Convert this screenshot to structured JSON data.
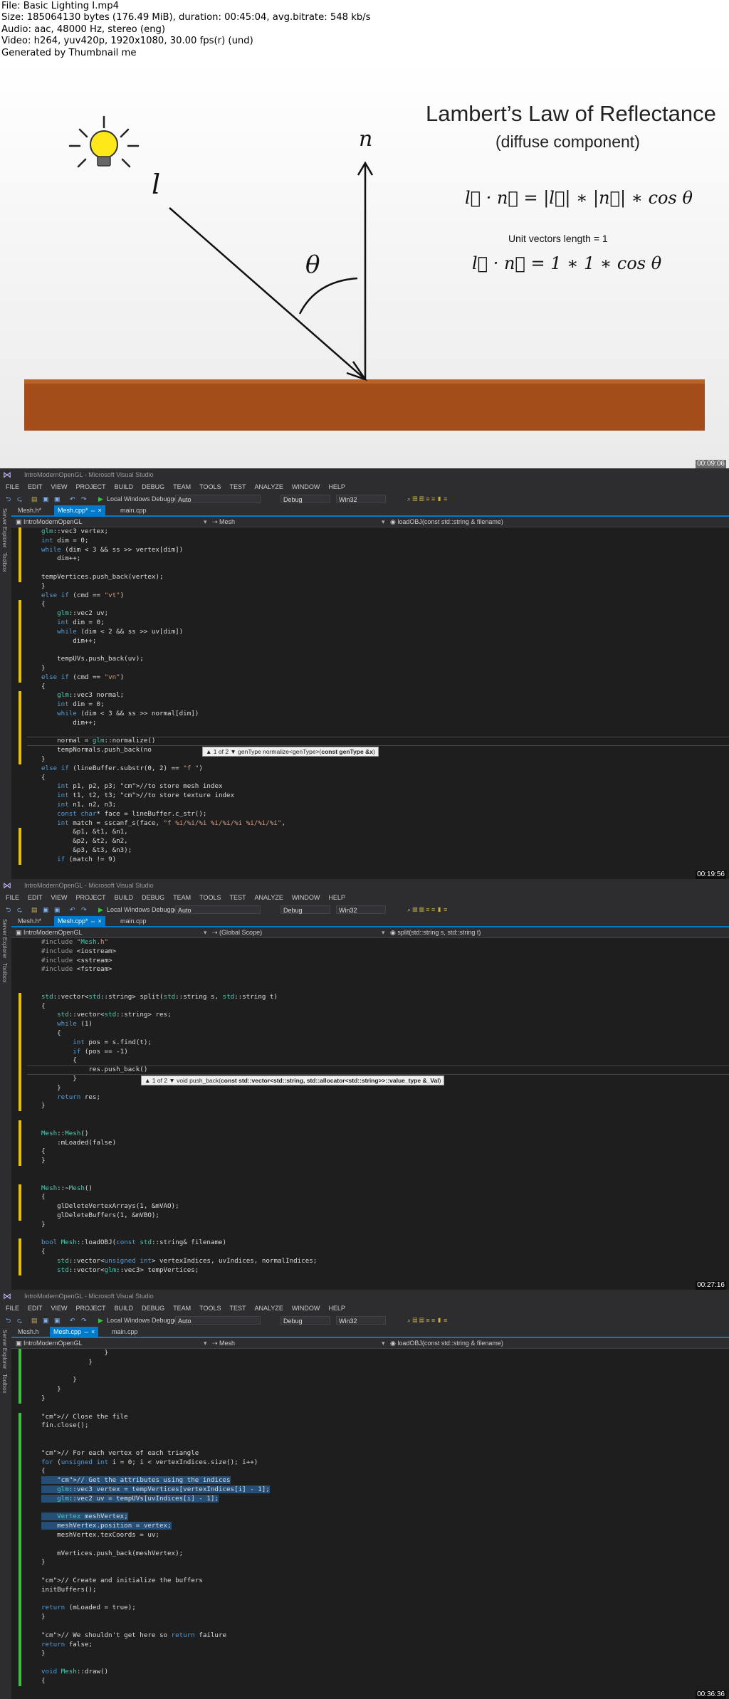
{
  "header": {
    "lines": [
      "File: Basic Lighting I.mp4",
      "Size: 185064130 bytes (176.49 MiB), duration: 00:45:04, avg.bitrate: 548 kb/s",
      "Audio: aac, 48000 Hz, stereo (eng)",
      "Video: h264, yuv420p, 1920x1080, 30.00 fps(r) (und)",
      "Generated by Thumbnail me"
    ]
  },
  "slide": {
    "title": "Lambert’s Law of Reflectance",
    "subtitle": "(diffuse component)",
    "label_l": "l",
    "label_n": "n",
    "label_theta": "θ",
    "formula1": "l⃗ · n⃗ = |l⃗| ∗ |n⃗| ∗ cos θ",
    "unit_note": "Unit vectors length = 1",
    "formula2": "l⃗ · n⃗ = 1 ∗ 1 ∗ cos θ",
    "timestamp": "00:09:06"
  },
  "vs": {
    "window_title": "IntroModernOpenGL - Microsoft Visual Studio",
    "menu": [
      "FILE",
      "EDIT",
      "VIEW",
      "PROJECT",
      "BUILD",
      "DEBUG",
      "TEAM",
      "TOOLS",
      "TEST",
      "ANALYZE",
      "WINDOW",
      "HELP"
    ],
    "debugger_label": "Local Windows Debugger",
    "combo_auto": "Auto",
    "combo_config": "Debug",
    "combo_platform": "Win32",
    "side_server": "Server Explorer",
    "side_toolbox": "Toolbox",
    "project": "IntroModernOpenGL"
  },
  "frames": [
    {
      "tabs": [
        "Mesh.h*",
        "Mesh.cpp*",
        "main.cpp"
      ],
      "active_tab": 1,
      "nav_scope": "Mesh",
      "nav_member": "loadOBJ(const std::string & filename)",
      "timestamp": "00:19:56",
      "tooltip": {
        "prefix": "▲ 1 of 2 ▼  genType normalize<genType>(",
        "bold": "const genType &x",
        "suffix": ")"
      },
      "code": [
        "glm::vec3 vertex;",
        "int dim = 0;",
        "while (dim < 3 && ss >> vertex[dim])",
        "    dim++;",
        "",
        "tempVertices.push_back(vertex);",
        "}",
        "else if (cmd == \"vt\")",
        "{",
        "    glm::vec2 uv;",
        "    int dim = 0;",
        "    while (dim < 2 && ss >> uv[dim])",
        "        dim++;",
        "",
        "    tempUVs.push_back(uv);",
        "}",
        "else if (cmd == \"vn\")",
        "{",
        "    glm::vec3 normal;",
        "    int dim = 0;",
        "    while (dim < 3 && ss >> normal[dim])",
        "        dim++;",
        "",
        "    normal = glm::normalize()",
        "    tempNormals.push_back(no",
        "}",
        "else if (lineBuffer.substr(0, 2) == \"f \")",
        "{",
        "    int p1, p2, p3; //to store mesh index",
        "    int t1, t2, t3; //to store texture index",
        "    int n1, n2, n3;",
        "    const char* face = lineBuffer.c_str();",
        "    int match = sscanf_s(face, \"f %i/%i/%i %i/%i/%i %i/%i/%i\",",
        "        &p1, &t1, &n1,",
        "        &p2, &t2, &n2,",
        "        &p3, &t3, &n3);",
        "    if (match != 9)"
      ]
    },
    {
      "tabs": [
        "Mesh.h*",
        "Mesh.cpp*",
        "main.cpp"
      ],
      "active_tab": 1,
      "nav_scope": "(Global Scope)",
      "nav_member": "split(std::string s, std::string t)",
      "timestamp": "00:27:16",
      "tooltip": {
        "prefix": "▲ 1 of 2 ▼  void push_back(",
        "bold": "const std::vector<std::string, std::allocator<std::string>>::value_type &_Val",
        "suffix": ")"
      },
      "code": [
        "#include \"Mesh.h\"",
        "#include <iostream>",
        "#include <sstream>",
        "#include <fstream>",
        "",
        "",
        "std::vector<std::string> split(std::string s, std::string t)",
        "{",
        "    std::vector<std::string> res;",
        "    while (1)",
        "    {",
        "        int pos = s.find(t);",
        "        if (pos == -1)",
        "        {",
        "            res.push_back()",
        "        }",
        "    }",
        "    return res;",
        "}",
        "",
        "",
        "Mesh::Mesh()",
        "    :mLoaded(false)",
        "{",
        "}",
        "",
        "",
        "Mesh::~Mesh()",
        "{",
        "    glDeleteVertexArrays(1, &mVAO);",
        "    glDeleteBuffers(1, &mVBO);",
        "}",
        "",
        "bool Mesh::loadOBJ(const std::string& filename)",
        "{",
        "    std::vector<unsigned int> vertexIndices, uvIndices, normalIndices;",
        "    std::vector<glm::vec3> tempVertices;"
      ]
    },
    {
      "tabs": [
        "Mesh.h",
        "Mesh.cpp",
        "main.cpp"
      ],
      "active_tab": 1,
      "nav_scope": "Mesh",
      "nav_member": "loadOBJ(const std::string & filename)",
      "timestamp": "00:36:36",
      "code": [
        "                }",
        "            }",
        "",
        "        }",
        "    }",
        "}",
        "",
        "// Close the file",
        "fin.close();",
        "",
        "",
        "// For each vertex of each triangle",
        "for (unsigned int i = 0; i < vertexIndices.size(); i++)",
        "{",
        "    // Get the attributes using the indices",
        "    glm::vec3 vertex = tempVertices[vertexIndices[i] - 1];",
        "    glm::vec2 uv = tempUVs[uvIndices[i] - 1];",
        "",
        "    Vertex meshVertex;",
        "    meshVertex.position = vertex;",
        "    meshVertex.texCoords = uv;",
        "",
        "    mVertices.push_back(meshVertex);",
        "}",
        "",
        "// Create and initialize the buffers",
        "initBuffers();",
        "",
        "return (mLoaded = true);",
        "}",
        "",
        "// We shouldn't get here so return failure",
        "return false;",
        "}",
        "",
        "void Mesh::draw()",
        "{"
      ]
    }
  ]
}
